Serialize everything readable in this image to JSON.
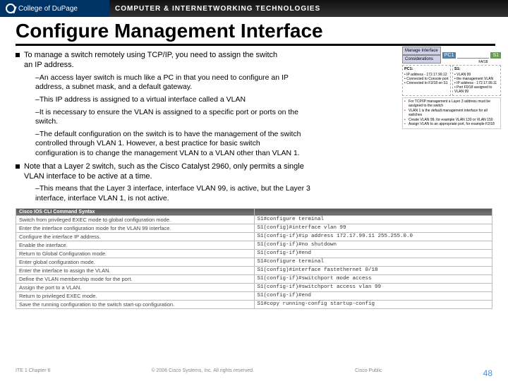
{
  "header": {
    "college": "College of DuPage",
    "program": "COMPUTER & INTERNETWORKING TECHNOLOGIES"
  },
  "title": "Configure Management Interface",
  "bullets": {
    "b1": "To manage a switch remotely using TCP/IP, you need to assign the switch an IP address.",
    "s1": "–An access layer switch is much like a PC in that you need to configure an IP address, a subnet mask, and a default gateway.",
    "s2": "–This IP address is assigned to a virtual interface called a VLAN",
    "s3": "–It is necessary to ensure the VLAN is assigned to a specific port or ports on the switch.",
    "s4": "–The default configuration on the switch is to have the management of the switch controlled through VLAN 1. However, a best practice for basic switch configuration is to change the management VLAN to a VLAN other than VLAN 1.",
    "b2": "Note that a Layer 2 switch, such as the Cisco Catalyst 2960, only permits a single VLAN interface to be active at a time.",
    "s5": "–This means that the Layer 3 interface, interface VLAN 99, is active, but the Layer 3 interface, interface VLAN 1, is not active."
  },
  "diagram": {
    "card1": "Manage Interface",
    "card2": "Considerations",
    "pc": "PC1",
    "s1": "S1",
    "fa": "FA/18",
    "pcbox_hd": "PC1:",
    "pcbox_l1": "• IP address - 172.17.99.12",
    "pcbox_l2": "• Connected to Console port",
    "pcbox_l3": "• Connected to F2/18 on S1",
    "s1box_hd": "S1:",
    "s1box_l1": "• VLAN 99",
    "s1box_l2": "• the management VLAN",
    "s1box_l3": "• IP address - 172.17.99.11",
    "s1box_l4": "• Port F0/18 assigned to VLAN 99",
    "tip1": "For TCP/IP management a Layer 3 address must be assigned to the switch",
    "tip2": "VLAN 1 is the default management interface for all switches",
    "tip3": "Create VLAN 99, for example VLAN 130 or VLAN 150",
    "tip4": "Assign VLAN to an appropriate port, for example F2/18"
  },
  "cli": {
    "hdr_left": "Cisco IOS CLI Command Syntax",
    "rows": [
      {
        "d": "Switch from privileged EXEC mode to global configuration mode.",
        "c": "S1#configure terminal"
      },
      {
        "d": "Enter the interface configuration mode for the VLAN 99 interface.",
        "c": "S1(config)#interface vlan 99"
      },
      {
        "d": "Configure the interface IP address.",
        "c": "S1(config-if)#ip address 172.17.99.11 255.255.0.0"
      },
      {
        "d": "Enable the interface.",
        "c": "S1(config-if)#no shutdown"
      },
      {
        "d": "Return to Global Configuration mode.",
        "c": "S1(config-if)#end"
      },
      {
        "d": "Enter global configuration mode.",
        "c": "S1#configure terminal"
      },
      {
        "d": "Enter the interface to assign the VLAN.",
        "c": "S1(config)#interface fastethernet 0/18"
      },
      {
        "d": "Define the VLAN membership mode for the port.",
        "c": "S1(config-if)#switchport mode access"
      },
      {
        "d": "Assign the port to a VLAN.",
        "c": "S1(config-if)#switchport access vlan 99"
      },
      {
        "d": "Return to privileged EXEC mode.",
        "c": "S1(config-if)#end"
      },
      {
        "d": "Save the running configuration to the switch start-up configuration.",
        "c": "S1#copy running-config startup-config"
      }
    ]
  },
  "footer": {
    "left": "ITE 1 Chapter 6",
    "mid": "© 2006 Cisco Systems, Inc. All rights reserved.",
    "right": "Cisco Public",
    "page": "48"
  }
}
